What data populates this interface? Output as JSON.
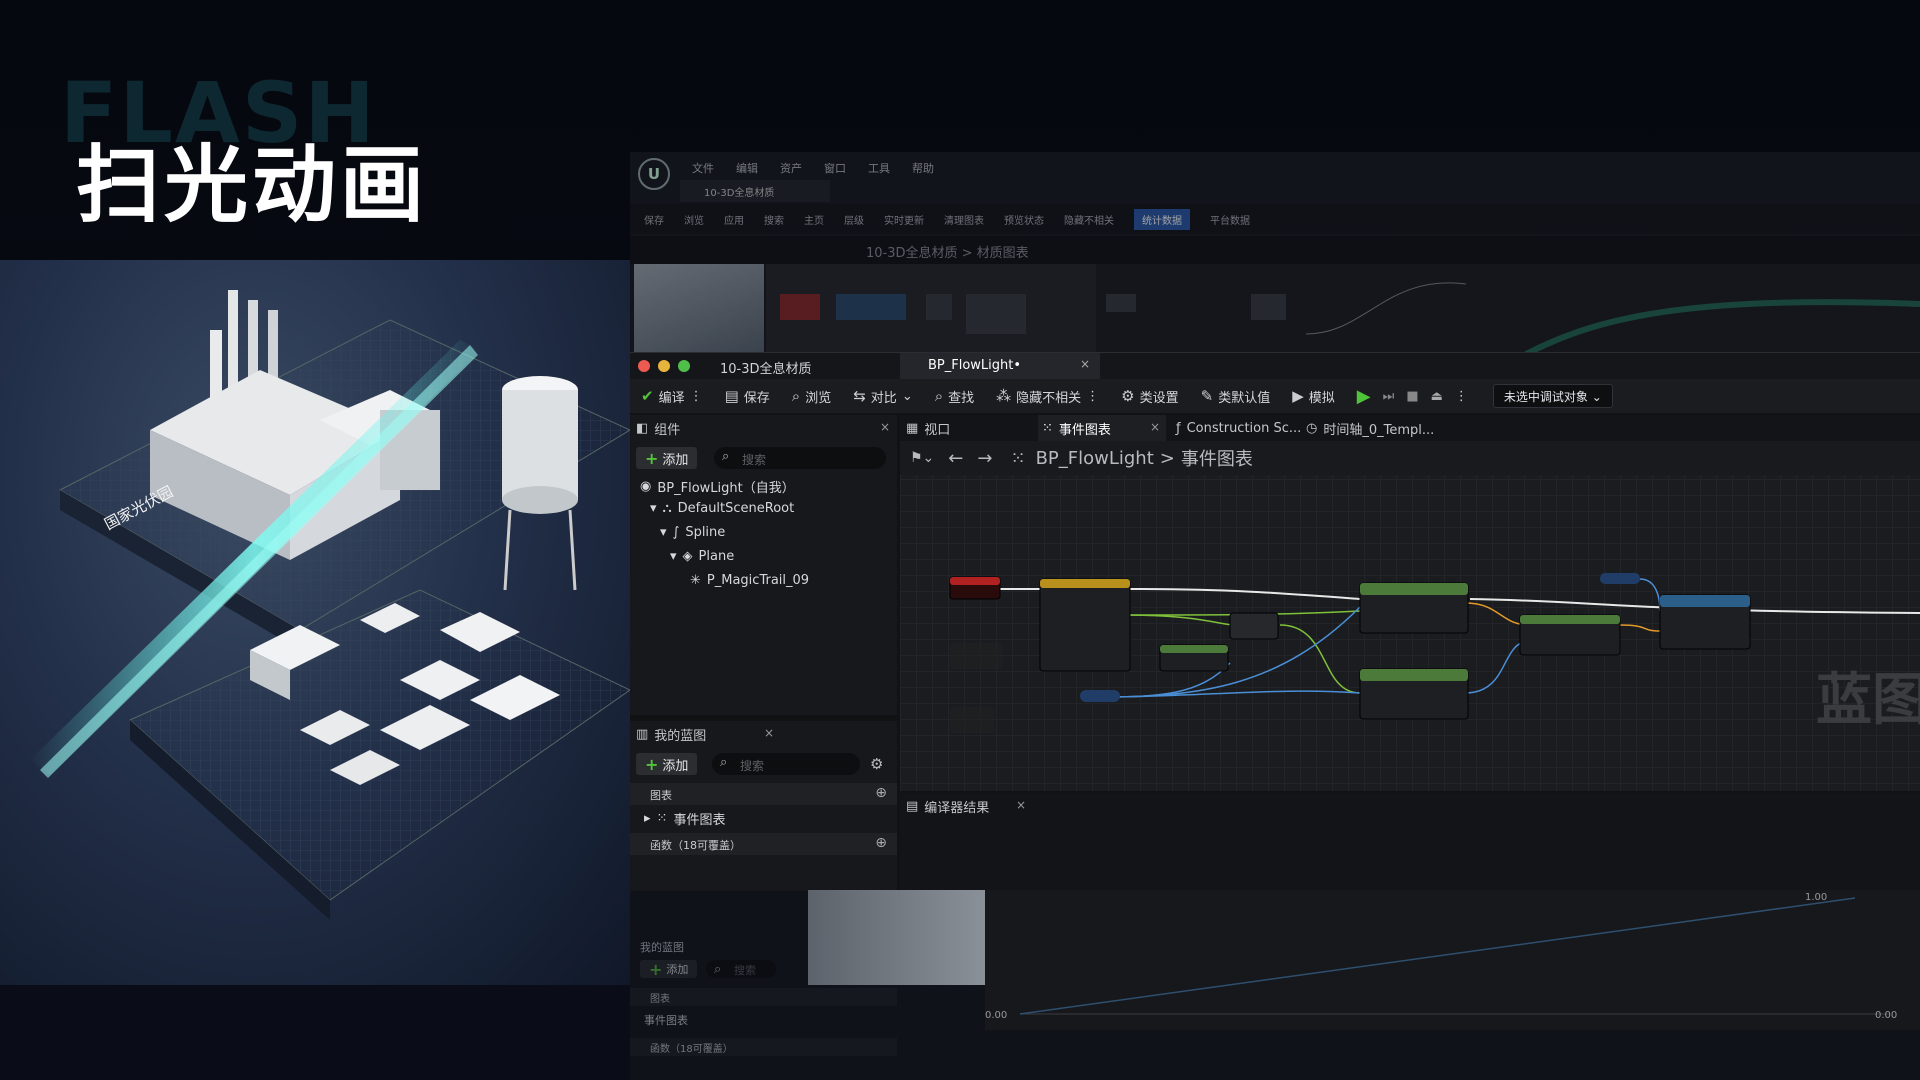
{
  "slide": {
    "bg_word": "FLASH",
    "title": "扫光动画"
  },
  "render": {
    "sign": "国家光伏园"
  },
  "bg_window": {
    "menu": [
      "文件",
      "编辑",
      "资产",
      "窗口",
      "工具",
      "帮助"
    ],
    "tab": "10-3D全息材质",
    "toolbar": [
      "保存",
      "浏览",
      "应用",
      "搜索",
      "主页",
      "层级",
      "实时更新",
      "清理图表",
      "预览状态",
      "隐藏不相关",
      "统计数据",
      "平台数据"
    ],
    "breadcrumb": "10-3D全息材质 > 材质图表"
  },
  "window": {
    "tab_material": "10-3D全息材质",
    "tab_blueprint": "BP_FlowLight•",
    "toolbar": {
      "compile": "编译",
      "save": "保存",
      "browse": "浏览",
      "diff": "对比",
      "find": "查找",
      "hide_unrelated": "隐藏不相关",
      "class_settings": "类设置",
      "class_defaults": "类默认值",
      "simulate": "模拟",
      "debug_target": "未选中调试对象"
    },
    "components": {
      "tab": "组件",
      "add": "添加",
      "search_placeholder": "搜索",
      "tree": [
        "BP_FlowLight（自我）",
        "DefaultSceneRoot",
        "Spline",
        "Plane",
        "P_MagicTrail_09"
      ]
    },
    "my_blueprint": {
      "tab": "我的蓝图",
      "add": "添加",
      "search_placeholder": "搜索",
      "graphs": "图表",
      "event_graph": "事件图表",
      "functions": "函数（18可覆盖）"
    },
    "graph_tabs": {
      "viewport": "视口",
      "event_graph": "事件图表",
      "construction": "Construction Sc...",
      "timeline": "时间轴_0_Templ..."
    },
    "breadcrumb": {
      "root": "BP_FlowLight",
      "sep": ">",
      "leaf": "事件图表"
    },
    "watermark": "蓝图",
    "compiler_tab": "编译器结果"
  },
  "lower": {
    "tab": "我的蓝图",
    "add": "添加",
    "search": "搜索",
    "graphs": "图表",
    "event_graph": "事件图表",
    "functions": "函数（18可覆盖）",
    "val_top": "1.00",
    "val_left": "0.00",
    "val_right": "0.00"
  },
  "colors": {
    "accent_green": "#56c23c",
    "accent_blue": "#2c5aa8",
    "exec_white": "#e8e8e8",
    "wire_green": "#7fc23a",
    "wire_blue": "#4a8fd6",
    "wire_orange": "#e39a2a"
  }
}
